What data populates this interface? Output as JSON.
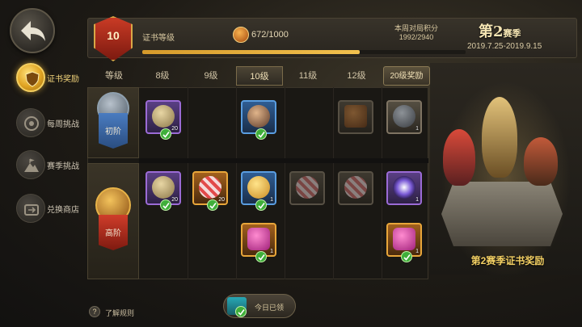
{
  "nav": {
    "items": [
      {
        "label": "证书奖励",
        "active": true
      },
      {
        "label": "每周挑战",
        "active": false
      },
      {
        "label": "赛季挑战",
        "active": false
      },
      {
        "label": "兑换商店",
        "active": false
      }
    ]
  },
  "header": {
    "level": "10",
    "cert_label": "证书等级",
    "xp_text": "672/1000",
    "xp_progress": 0.672,
    "week_label": "本周对局积分",
    "week_score": "1992/2940",
    "season_prefix": "第",
    "season_num": "2",
    "season_suffix": "赛季",
    "season_dates": "2019.7.25-2019.9.15"
  },
  "grid": {
    "tabs": [
      "等级",
      "8级",
      "9级",
      "10级",
      "11级",
      "12级",
      "20级奖励"
    ],
    "active_tab": "10级",
    "tiers": [
      {
        "label": "初阶",
        "color": "#3a6aa8"
      },
      {
        "label": "高阶",
        "color": "#b83324"
      }
    ],
    "basic_items": [
      {
        "count": "20",
        "claimed": true
      },
      {
        "count": "",
        "claimed": true
      },
      {
        "count": "",
        "claimed": false
      },
      {
        "count": "1",
        "claimed": false
      }
    ],
    "advanced_items": [
      {
        "count": "20",
        "claimed": true
      },
      {
        "count": "20",
        "claimed": true
      },
      {
        "count": "1",
        "claimed": true
      },
      {
        "count": "",
        "claimed": false
      },
      {
        "count": "",
        "claimed": false
      },
      {
        "count": "1",
        "claimed": false
      },
      {
        "count": "1",
        "claimed": true
      },
      {
        "count": "1",
        "claimed": true
      }
    ]
  },
  "art": {
    "reward_label": "第2赛季证书奖励"
  },
  "footer": {
    "help_icon": "?",
    "help_text": "了解规则",
    "claim_text": "今日已领"
  },
  "colors": {
    "accent": "#f2c14e",
    "claimed": "#3fae3a",
    "epic": "#9b6bd6",
    "legendary": "#e8a63a"
  }
}
